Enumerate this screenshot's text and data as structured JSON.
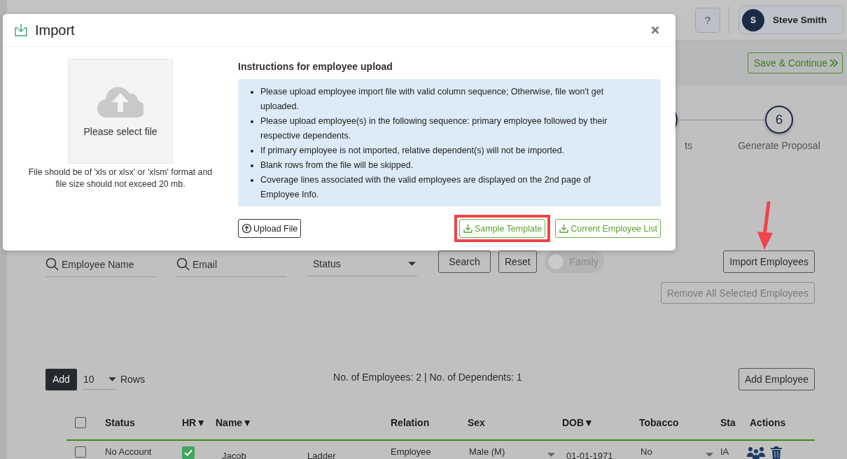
{
  "header": {
    "help": "?",
    "user": {
      "initial": "S",
      "name": "Steve Smith"
    }
  },
  "save_button": "Save & Continue",
  "steps": [
    {
      "label": "ts"
    },
    {
      "number": "6",
      "label": "Generate Proposal"
    }
  ],
  "filters": {
    "name_placeholder": "Employee Name",
    "email_placeholder": "Email",
    "status_placeholder": "Status",
    "search": "Search",
    "reset": "Reset",
    "family": {
      "label": "Family",
      "on": false,
      "disabled": true
    },
    "import": "Import Employees",
    "remove": {
      "label": "Remove All Selected Employees",
      "disabled": true
    }
  },
  "paging": {
    "add": "Add",
    "rows_value": "10",
    "rows_label": "Rows",
    "counts": "No. of Employees: 2 | No. of Dependents: 1",
    "add_employee": "Add Employee"
  },
  "table": {
    "header_checked": false,
    "columns": [
      "Status",
      "HR▼",
      "Name▼",
      "Relation",
      "Sex",
      "DOB▼",
      "Tobacco",
      "Sta",
      "Actions"
    ],
    "rows": [
      {
        "checked": false,
        "status": "No Account",
        "hr": true,
        "first_name": "Jacob",
        "last_name": "Ladder",
        "relation": "Employee",
        "sex": "Male (M)",
        "dob": "01-01-1971",
        "tobacco": "No",
        "state": "IA"
      }
    ]
  },
  "modal": {
    "title": "Import",
    "dropzone": "Please select file",
    "hint": "File should be of 'xls or xlsx' or 'xlsm' format and file size should not exceed 20 mb.",
    "instructions_title": "Instructions for employee upload",
    "instructions": [
      "Please upload employee import file with valid column sequence; Otherwise, file won't get uploaded.",
      "Please upload employee(s) in the following sequence: primary employee followed by their respective dependents.",
      "If primary employee is not imported, relative dependent(s) will not be imported.",
      "Blank rows from the file will be skipped.",
      "Coverage lines associated with the valid employees are displayed on the 2nd page of Employee Info."
    ],
    "buttons": [
      {
        "label": "Upload File",
        "kind": "upload",
        "highlighted": false
      },
      {
        "label": "Sample Template",
        "kind": "download",
        "highlighted": true
      },
      {
        "label": "Current Employee List",
        "kind": "download",
        "highlighted": false
      }
    ]
  }
}
